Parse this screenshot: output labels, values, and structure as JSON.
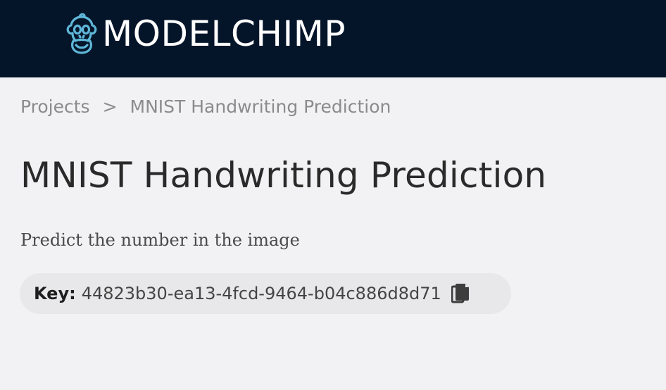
{
  "header": {
    "logo_text": "MODELCHIMP",
    "logo_icon": "chimp-face-icon",
    "background": "#04152a",
    "logo_accent": "#5fb7d8"
  },
  "breadcrumb": {
    "items": [
      {
        "label": "Projects"
      },
      {
        "label": "MNIST Handwriting Prediction"
      }
    ],
    "separator": ">"
  },
  "project": {
    "title": "MNIST Handwriting Prediction",
    "description": "Predict the number in the image",
    "key_label": "Key:",
    "key_value": "44823b30-ea13-4fcd-9464-b04c886d8d71",
    "copy_icon": "copy-icon"
  }
}
